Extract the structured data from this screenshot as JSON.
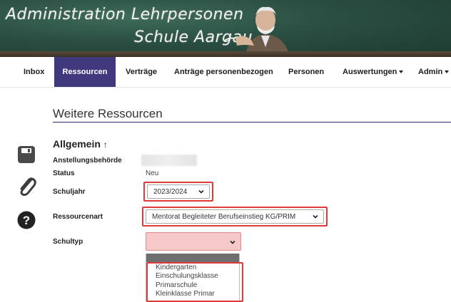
{
  "banner": {
    "title": "Administration Lehrpersonen",
    "subtitle": "Schule Aargau"
  },
  "nav": {
    "items": [
      {
        "label": "Inbox"
      },
      {
        "label": "Ressourcen"
      },
      {
        "label": "Verträge"
      },
      {
        "label": "Anträge personenbezogen"
      },
      {
        "label": "Personen"
      },
      {
        "label": "Auswertungen"
      },
      {
        "label": "Admin"
      }
    ]
  },
  "page": {
    "title": "Weitere Ressourcen"
  },
  "section": {
    "title": "Allgemein",
    "arrow": "↑"
  },
  "form": {
    "anstellungsbehoerde_label": "Anstellungsbehörde",
    "status_label": "Status",
    "status_value": "Neu",
    "schuljahr_label": "Schuljahr",
    "schuljahr_value": "2023/2024",
    "ressourcenart_label": "Ressourcenart",
    "ressourcenart_value": "Mentorat Begleiteter Berufseinstieg KG/PRIM",
    "schultyp_label": "Schultyp",
    "schultyp_value": "",
    "schultyp_options": [
      "Kindergarten",
      "Einschulungsklasse",
      "Primarschule",
      "Kleinklasse Primar"
    ]
  },
  "icons": {
    "save": "floppy-disk-icon",
    "attach": "paperclip-icon",
    "help": "question-circle-icon"
  },
  "colors": {
    "accent": "#3f3a7e",
    "highlight": "#e03a3a",
    "invalid_fill": "#f6c9c9"
  }
}
